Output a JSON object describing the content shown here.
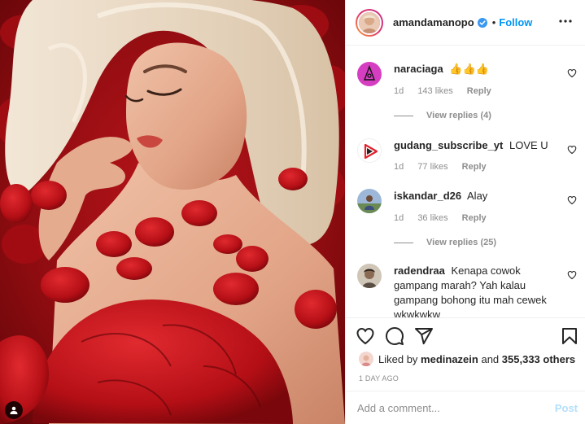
{
  "post": {
    "username": "amandamanopo",
    "verified": true,
    "follow_label": "Follow",
    "separator": "•",
    "tag_icon": "person-tag-icon"
  },
  "comments": [
    {
      "username": "naraciaga",
      "text": "👍👍👍",
      "time": "1d",
      "likes": "143 likes",
      "reply": "Reply",
      "view_replies": "View replies (4)",
      "avatar_color": "#d63ec1"
    },
    {
      "username": "gudang_subscribe_yt",
      "text": "LOVE U",
      "time": "1d",
      "likes": "77 likes",
      "reply": "Reply",
      "avatar_color": "#ffffff"
    },
    {
      "username": "iskandar_d26",
      "text": "Alay",
      "time": "1d",
      "likes": "36 likes",
      "reply": "Reply",
      "view_replies": "View replies (25)",
      "avatar_color": "#6a8a55"
    },
    {
      "username": "radendraa",
      "text": "Kenapa cowok gampang marah? Yah kalau gampang bohong itu mah cewek wkwkwkw",
      "avatar_color": "#8a7a66"
    }
  ],
  "actions": {
    "like_icon": "heart-icon",
    "comment_icon": "comment-icon",
    "share_icon": "share-icon",
    "save_icon": "bookmark-icon"
  },
  "likes": {
    "prefix": "Liked by",
    "user": "medinazein",
    "middle": "and",
    "others": "355,333 others"
  },
  "timestamp": "1 DAY AGO",
  "add_comment": {
    "placeholder": "Add a comment...",
    "post_label": "Post"
  },
  "colors": {
    "link": "#0095f6",
    "muted": "#8e8e8e",
    "text": "#262626",
    "post_disabled": "#b2dffc"
  }
}
